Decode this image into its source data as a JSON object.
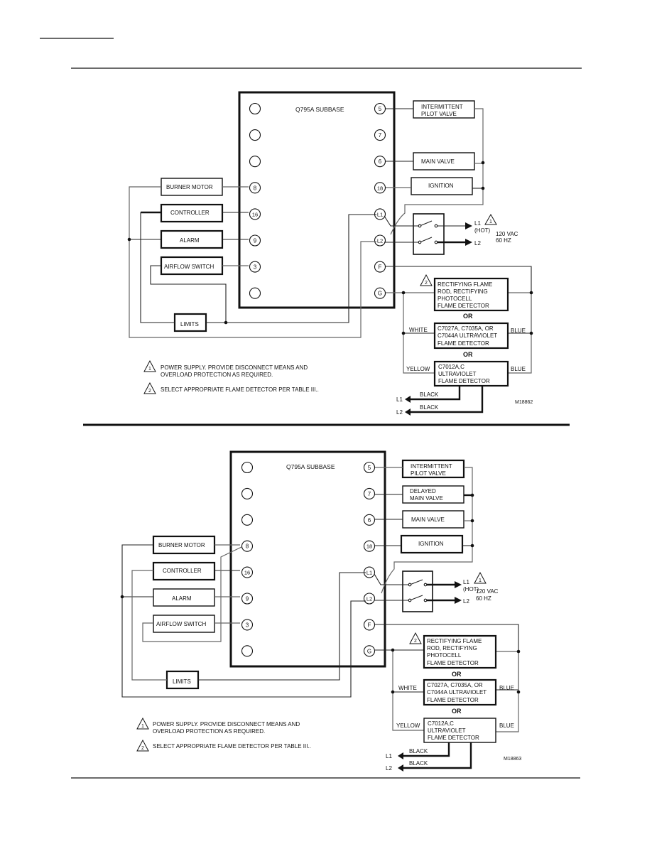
{
  "page": {
    "header_rule": true,
    "footer_rule": true
  },
  "diagrams": [
    {
      "id": "M18862",
      "subbase_label": "Q795A SUBBASE",
      "left_terminals": [
        "",
        "",
        "",
        "8",
        "16",
        "9",
        "3",
        ""
      ],
      "right_terminals": [
        "5",
        "7",
        "6",
        "18",
        "L1",
        "L2",
        "F",
        "G"
      ],
      "right_devices": [
        {
          "lines": [
            "INTERMITTENT",
            "PILOT VALVE"
          ],
          "terminal": "5"
        },
        {
          "lines": [
            "MAIN VALVE"
          ],
          "terminal": "6"
        },
        {
          "lines": [
            "IGNITION"
          ],
          "terminal": "18"
        }
      ],
      "left_devices": [
        {
          "label": "BURNER MOTOR",
          "terminal": "8"
        },
        {
          "label": "CONTROLLER",
          "terminal": "16"
        },
        {
          "label": "ALARM",
          "terminal": "9"
        },
        {
          "label": "AIRFLOW SWITCH",
          "terminal": "3"
        }
      ],
      "limits_label": "LIMITS",
      "power": {
        "l1": "L1",
        "hot": "(HOT)",
        "l2": "L2",
        "voltage": "120 VAC",
        "freq": "60 HZ",
        "note_mark": "1"
      },
      "detectors": [
        {
          "lines": [
            "RECTIFYING FLAME",
            "ROD, RECTIFYING",
            "PHOTOCELL",
            "FLAME DETECTOR"
          ],
          "note_mark": "2"
        },
        {
          "lines": [
            "C7027A, C7035A, OR",
            "C7044A ULTRAVIOLET",
            "FLAME DETECTOR"
          ],
          "left_wire": "WHITE",
          "right_wire": "BLUE"
        },
        {
          "lines": [
            "C7012A,C",
            "ULTRAVIOLET",
            "FLAME DETECTOR"
          ],
          "left_wire": "YELLOW",
          "right_wire": "BLUE"
        }
      ],
      "or_label": "OR",
      "black_leads": [
        {
          "to": "L1",
          "label": "BLACK"
        },
        {
          "to": "L2",
          "label": "BLACK"
        }
      ],
      "notes": [
        {
          "mark": "1",
          "lines": [
            "POWER SUPPLY. PROVIDE DISCONNECT MEANS AND",
            "OVERLOAD PROTECTION AS REQUIRED."
          ]
        },
        {
          "mark": "2",
          "lines": [
            "SELECT APPROPRIATE FLAME DETECTOR PER TABLE III.."
          ]
        }
      ],
      "figure_code": "M18862"
    },
    {
      "id": "M18863",
      "subbase_label": "Q795A SUBBASE",
      "left_terminals": [
        "",
        "",
        "",
        "8",
        "16",
        "9",
        "3",
        ""
      ],
      "right_terminals": [
        "5",
        "7",
        "6",
        "18",
        "L1",
        "L2",
        "F",
        "G"
      ],
      "right_devices": [
        {
          "lines": [
            "INTERMITTENT",
            "PILOT VALVE"
          ],
          "terminal": "5"
        },
        {
          "lines": [
            "DELAYED",
            "MAIN VALVE"
          ],
          "terminal": "7"
        },
        {
          "lines": [
            "MAIN VALVE"
          ],
          "terminal": "6"
        },
        {
          "lines": [
            "IGNITION"
          ],
          "terminal": "18"
        }
      ],
      "left_devices": [
        {
          "label": "BURNER MOTOR",
          "terminal": "8"
        },
        {
          "label": "CONTROLLER",
          "terminal": "16"
        },
        {
          "label": "ALARM",
          "terminal": "9"
        },
        {
          "label": "AIRFLOW SWITCH",
          "terminal": "3"
        }
      ],
      "limits_label": "LIMITS",
      "power": {
        "l1": "L1",
        "hot": "(HOT)",
        "l2": "L2",
        "voltage": "120 VAC",
        "freq": "60 HZ",
        "note_mark": "1"
      },
      "detectors": [
        {
          "lines": [
            "RECTIFYING FLAME",
            "ROD, RECTIFYING",
            "PHOTOCELL",
            "FLAME DETECTOR"
          ],
          "note_mark": "2"
        },
        {
          "lines": [
            "C7027A, C7035A, OR",
            "C7044A ULTRAVIOLET",
            "FLAME DETECTOR"
          ],
          "left_wire": "WHITE",
          "right_wire": "BLUE"
        },
        {
          "lines": [
            "C7012A,C",
            "ULTRAVIOLET",
            "FLAME DETECTOR"
          ],
          "left_wire": "YELLOW",
          "right_wire": "BLUE"
        }
      ],
      "or_label": "OR",
      "black_leads": [
        {
          "to": "L1",
          "label": "BLACK"
        },
        {
          "to": "L2",
          "label": "BLACK"
        }
      ],
      "notes": [
        {
          "mark": "1",
          "lines": [
            "POWER SUPPLY. PROVIDE DISCONNECT MEANS AND",
            "OVERLOAD PROTECTION AS REQUIRED."
          ]
        },
        {
          "mark": "2",
          "lines": [
            "SELECT APPROPRIATE FLAME DETECTOR PER TABLE III.."
          ]
        }
      ],
      "figure_code": "M18863"
    }
  ]
}
